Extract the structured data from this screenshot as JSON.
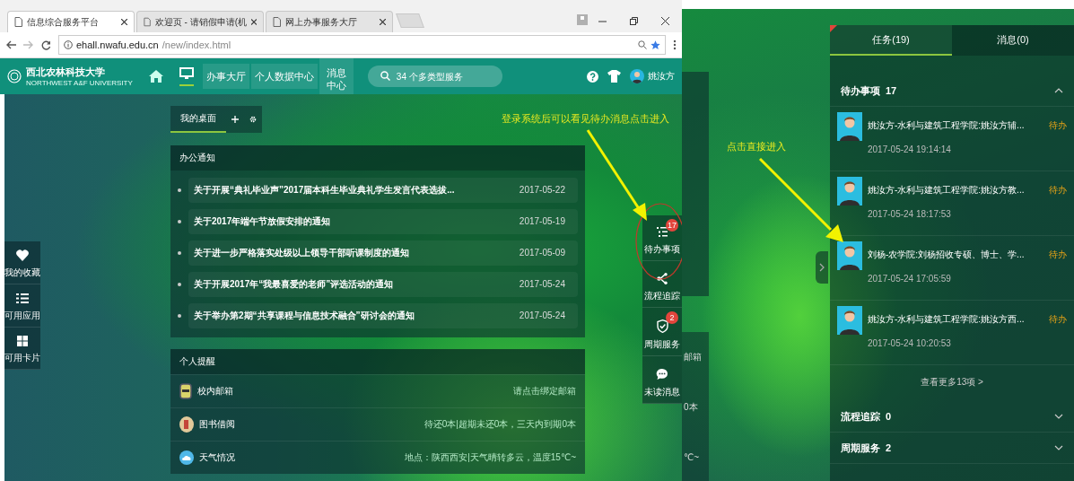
{
  "left_screen": {
    "browser": {
      "tabs": [
        {
          "title": "信息综合服务平台",
          "selected": true
        },
        {
          "title": "欢迎页 - 请销假申请(机",
          "selected": false
        },
        {
          "title": "网上办事服务大厅",
          "selected": false
        }
      ],
      "url_host": "ehall.nwafu.edu.cn",
      "url_path": "/new/index.html"
    },
    "header": {
      "logo_name": "西北农林科技大学",
      "logo_subtitle": "NORTHWEST A&F UNIVERSITY",
      "menu": [
        {
          "label": "办事大厅"
        },
        {
          "label": "个人数据中心"
        },
        {
          "label": "消息中心"
        }
      ],
      "search": {
        "placeholder": "34 个多类型服务"
      },
      "user_name": "姚汝方"
    },
    "left_dock": [
      {
        "kind": "favorites",
        "label": "我的收藏"
      },
      {
        "kind": "apps",
        "label": "可用应用"
      },
      {
        "kind": "cards",
        "label": "可用卡片"
      }
    ],
    "desktop_tabs": [
      {
        "label": "我的桌面",
        "selected": true
      }
    ],
    "notices": {
      "title": "办公通知",
      "items": [
        {
          "text": "关于开展“典礼毕业声”2017届本科生毕业典礼学生发言代表选拔...",
          "date": "2017-05-22"
        },
        {
          "text": "关于2017年端午节放假安排的通知",
          "date": "2017-05-19"
        },
        {
          "text": "关于进一步严格落实处级以上领导干部听课制度的通知",
          "date": "2017-05-09"
        },
        {
          "text": "关于开展2017年“我最喜爱的老师”评选活动的通知",
          "date": "2017-05-24"
        },
        {
          "text": "关于举办第2期“共享课程与信息技术融合”研讨会的通知",
          "date": "2017-05-24"
        }
      ]
    },
    "reminders": {
      "title": "个人提醒",
      "items": [
        {
          "kind": "mail",
          "label": "校内邮箱",
          "value": "请点击绑定邮箱"
        },
        {
          "kind": "library",
          "label": "图书借阅",
          "value": "待还0本|超期未还0本，三天内到期0本"
        },
        {
          "kind": "weather",
          "label": "天气情况",
          "value": "地点：陕西西安|天气晴转多云，温度15℃~"
        }
      ]
    },
    "right_dock": [
      {
        "kind": "todo",
        "label": "待办事项",
        "badge": "17",
        "highlighted": true
      },
      {
        "kind": "flow",
        "label": "流程追踪",
        "highlighted": false
      },
      {
        "kind": "periodic",
        "label": "周期服务",
        "badge": "2",
        "highlighted": false
      },
      {
        "kind": "messages",
        "label": "未读消息",
        "highlighted": false
      }
    ],
    "annotation": "登录系统后可以看见待办消息点击进入"
  },
  "right_screen": {
    "background_fragments": [
      "邮箱",
      "0本",
      "℃~"
    ],
    "annotation": "点击直接进入",
    "panel": {
      "tabs": [
        {
          "label": "任务(19)",
          "selected": true
        },
        {
          "label": "消息(0)",
          "selected": false
        }
      ],
      "sections": [
        {
          "title": "待办事项",
          "count": "17",
          "expanded": true,
          "items": [
            {
              "title": "姚汝方-水利与建筑工程学院:姚汝方辅...",
              "status": "待办",
              "time": "2017-05-24 19:14:14"
            },
            {
              "title": "姚汝方-水利与建筑工程学院:姚汝方教...",
              "status": "待办",
              "time": "2017-05-24 18:17:53"
            },
            {
              "title": "刘杨-农学院:刘杨招收专硕、博士、学...",
              "status": "待办",
              "time": "2017-05-24 17:05:59"
            },
            {
              "title": "姚汝方-水利与建筑工程学院:姚汝方西...",
              "status": "待办",
              "time": "2017-05-24 10:20:53"
            }
          ],
          "more": "查看更多13项 >"
        },
        {
          "title": "流程追踪",
          "count": "0",
          "expanded": false
        },
        {
          "title": "周期服务",
          "count": "2",
          "expanded": false
        }
      ]
    }
  }
}
